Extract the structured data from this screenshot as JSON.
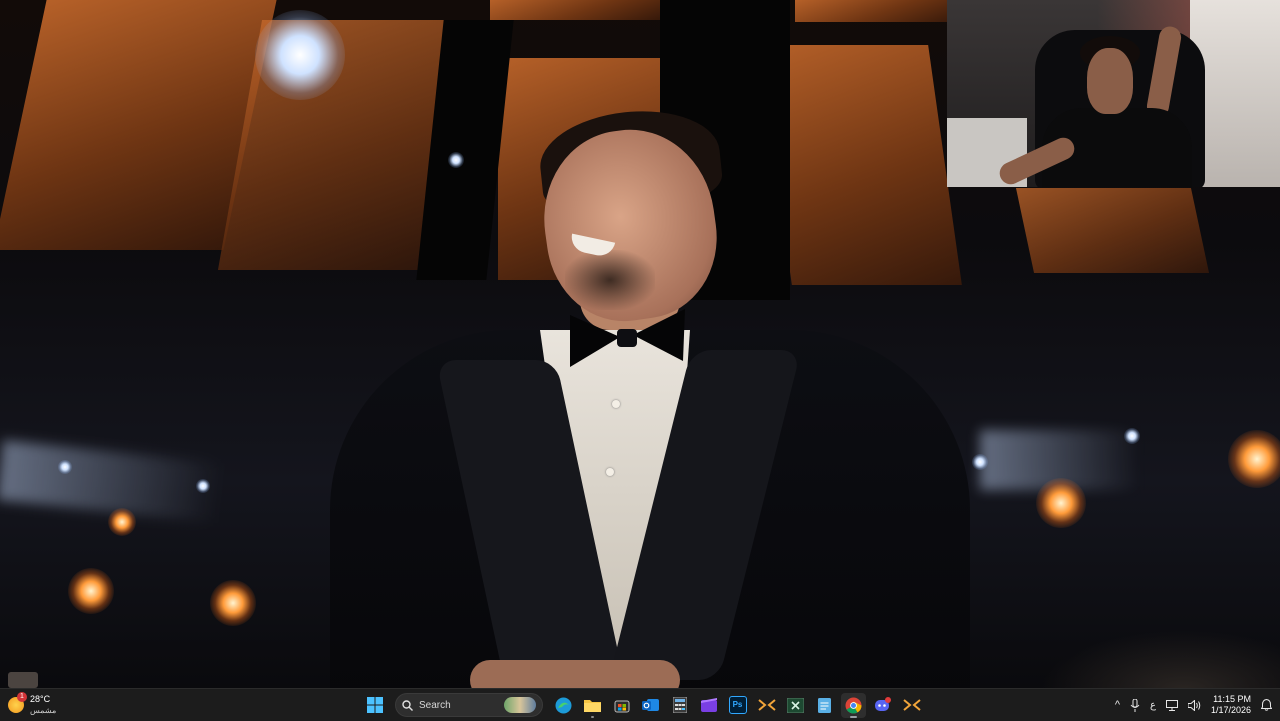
{
  "taskbar": {
    "weather": {
      "temperature": "28°C",
      "condition": "مشمس",
      "badge": "1",
      "icon": "sunny-weather-icon"
    },
    "search": {
      "placeholder": "Search"
    },
    "apps": [
      {
        "name": "start",
        "icon": "windows-logo-icon"
      },
      {
        "name": "edge",
        "icon": "edge-browser-icon"
      },
      {
        "name": "file-explorer",
        "icon": "folder-icon"
      },
      {
        "name": "microsoft-store",
        "icon": "store-icon"
      },
      {
        "name": "outlook",
        "icon": "outlook-icon"
      },
      {
        "name": "calculator",
        "icon": "calculator-icon"
      },
      {
        "name": "clipchamp",
        "icon": "video-editor-icon"
      },
      {
        "name": "photoshop",
        "icon": "photoshop-icon",
        "label": "Ps"
      },
      {
        "name": "app-arrows",
        "icon": "arrows-app-icon"
      },
      {
        "name": "excel",
        "icon": "excel-icon"
      },
      {
        "name": "notepad",
        "icon": "notepad-icon"
      },
      {
        "name": "chrome",
        "icon": "chrome-icon"
      },
      {
        "name": "discord",
        "icon": "discord-icon"
      },
      {
        "name": "app-arrows-2",
        "icon": "arrows-app-icon"
      }
    ],
    "tray": {
      "chevron": "^",
      "language": "ع",
      "time": "11:15 PM",
      "date": "1/17/2026"
    }
  }
}
